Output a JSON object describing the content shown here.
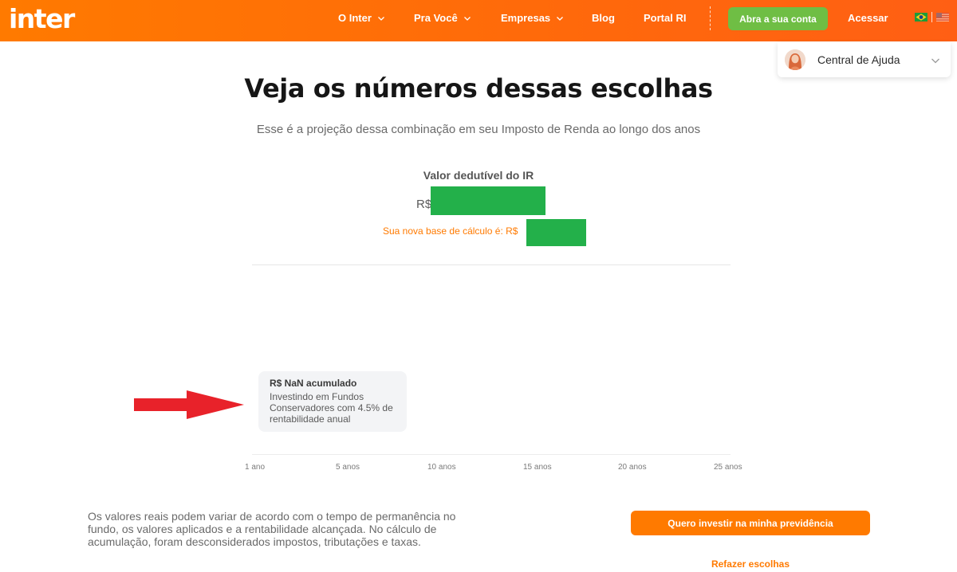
{
  "brand": {
    "logo_text": "inter"
  },
  "nav": {
    "items": [
      {
        "label": "O Inter",
        "has_dropdown": true
      },
      {
        "label": "Pra Você",
        "has_dropdown": true
      },
      {
        "label": "Empresas",
        "has_dropdown": true
      },
      {
        "label": "Blog",
        "has_dropdown": false
      },
      {
        "label": "Portal RI",
        "has_dropdown": false
      }
    ],
    "open_account_label": "Abra a sua conta",
    "login_label": "Acessar",
    "languages": [
      "brazil-flag-icon",
      "us-flag-icon"
    ]
  },
  "help_widget": {
    "label": "Central de Ajuda",
    "icon": "chevron-down-icon"
  },
  "main": {
    "title": "Veja os números dessas escolhas",
    "subtitle": "Esse é a projeção dessa combinação em seu Imposto de Renda ao longo dos anos",
    "deductible_label": "Valor dedutível do IR",
    "deductible_currency": "R$",
    "new_base_label": "Sua nova base de cálculo é: R$"
  },
  "chart": {
    "tooltip_title": "R$ NaN acumulado",
    "tooltip_body": "Investindo em Fundos Conservadores com 4.5% de rentabilidade anual",
    "ticks": [
      "1 ano",
      "5 anos",
      "10 anos",
      "15 anos",
      "20 anos",
      "25 anos"
    ]
  },
  "footer": {
    "disclaimer": "Os valores reais podem variar de acordo com o tempo de permanência no fundo, os valores aplicados e a rentabilidade alcançada. No cálculo de acumulação, foram desconsiderados impostos, tributações e taxas.",
    "cta_label": "Quero investir na minha previdência",
    "redo_label": "Refazer escolhas"
  },
  "colors": {
    "brand_orange": "#ff7a00",
    "account_green": "#6fbe44",
    "redaction_green": "#23b04a",
    "annotation_red": "#e8222a"
  }
}
